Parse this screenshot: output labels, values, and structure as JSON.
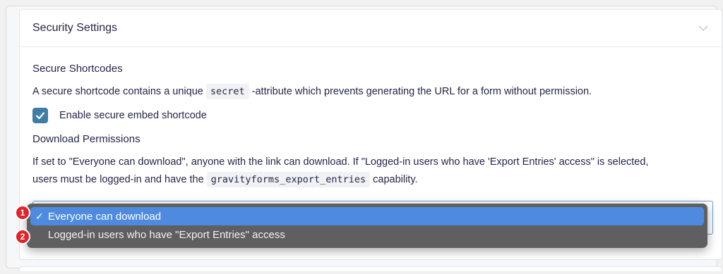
{
  "panel": {
    "title": "Security Settings",
    "toggle_icon": "chevron-down-icon"
  },
  "secure_shortcodes": {
    "title": "Secure Shortcodes",
    "description_before": "A secure shortcode contains a unique ",
    "description_code": "secret",
    "description_after": " -attribute which prevents generating the URL for a form without permission.",
    "checkbox_label": "Enable secure embed shortcode",
    "checkbox_checked": true
  },
  "download_permissions": {
    "title": "Download Permissions",
    "description_line1": "If set to \"Everyone can download\", anyone with the link can download. If \"Logged-in users who have 'Export Entries' access\" is selected,",
    "description_line2_before": "users must be logged-in and have the ",
    "description_code": "gravityforms_export_entries",
    "description_line2_after": " capability."
  },
  "dropdown": {
    "options": [
      {
        "label": "Everyone can download",
        "selected": true,
        "check": "✓"
      },
      {
        "label": "Logged-in users who have \"Export Entries\" access",
        "selected": false
      }
    ]
  },
  "badges": [
    "1",
    "2"
  ],
  "colors": {
    "accent": "#4e8be0",
    "checkbox": "#3e7da6",
    "badge": "#e0242c",
    "menu_bg": "#5f5f61"
  }
}
